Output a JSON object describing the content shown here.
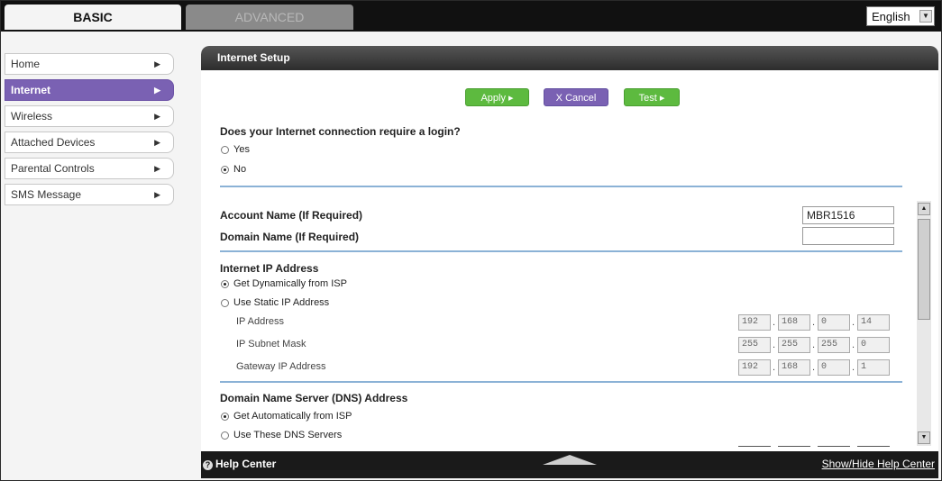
{
  "top_tabs": {
    "basic": "BASIC",
    "advanced": "ADVANCED"
  },
  "language": {
    "selected": "English"
  },
  "sidebar": {
    "items": [
      {
        "label": "Home"
      },
      {
        "label": "Internet"
      },
      {
        "label": "Wireless"
      },
      {
        "label": "Attached Devices"
      },
      {
        "label": "Parental Controls"
      },
      {
        "label": "SMS Message"
      }
    ]
  },
  "panel": {
    "title": "Internet Setup",
    "buttons": {
      "apply": "Apply ▸",
      "cancel": "X Cancel",
      "test": "Test ▸"
    },
    "login_question": "Does your Internet connection require a login?",
    "login_options": {
      "yes": "Yes",
      "no": "No"
    },
    "account_name_label": "Account Name  (If Required)",
    "account_name_value": "MBR1516",
    "domain_name_label": "Domain Name  (If Required)",
    "domain_name_value": "",
    "ip_section": "Internet IP Address",
    "ip_options": {
      "dynamic": "Get Dynamically from ISP",
      "static": "Use Static IP Address"
    },
    "ip_address_label": "IP Address",
    "ip_address": [
      "192",
      "168",
      "0",
      "14"
    ],
    "subnet_label": "IP Subnet Mask",
    "subnet": [
      "255",
      "255",
      "255",
      "0"
    ],
    "gateway_label": "Gateway IP Address",
    "gateway": [
      "192",
      "168",
      "0",
      "1"
    ],
    "dns_section": "Domain Name Server (DNS) Address",
    "dns_options": {
      "auto": "Get Automatically from ISP",
      "manual": "Use These DNS Servers"
    }
  },
  "footer": {
    "help": "Help Center",
    "toggle": "Show/Hide Help Center"
  },
  "colors": {
    "accent_purple": "#7a61b3",
    "button_green": "#5dba3f",
    "divider_blue": "#8bb2d6"
  }
}
